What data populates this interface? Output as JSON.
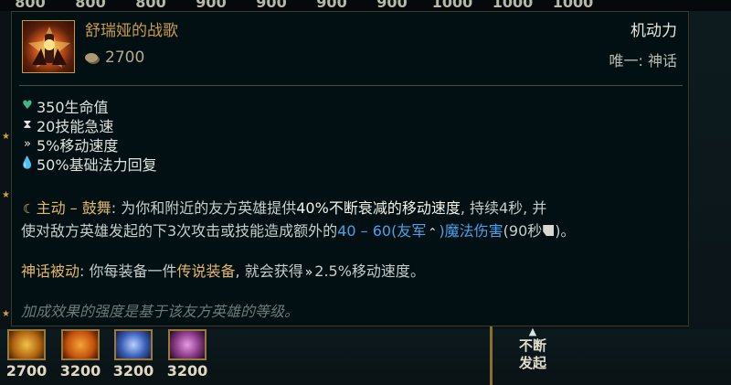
{
  "background": {
    "top_prices": [
      "800",
      "800",
      "800",
      "900",
      "900",
      "900",
      "900",
      "1000",
      "1000",
      "1000"
    ],
    "shop_items": [
      {
        "price": "2700",
        "color": "#d08a1c"
      },
      {
        "price": "3200",
        "color": "#d36a10"
      },
      {
        "price": "3200",
        "color": "#3a5fb8"
      },
      {
        "price": "3200",
        "color": "#8a3a88"
      }
    ],
    "side_item": {
      "line1": "不断",
      "line2": "发起"
    }
  },
  "tooltip": {
    "item_name": "舒瑞娅的战歌",
    "cost": "2700",
    "category": "机动力",
    "unique": "唯一: 神话",
    "stats": [
      {
        "icon": "heart-icon",
        "text": "350生命值"
      },
      {
        "icon": "hourglass-icon",
        "text": "20技能急速"
      },
      {
        "icon": "movement-speed-icon",
        "text": "5%移动速度"
      },
      {
        "icon": "mana-regen-icon",
        "text": "50%基础法力回复"
      }
    ],
    "active": {
      "label": "主动 – 鼓舞",
      "colon": ":",
      "t1": "为你和附近的友方英雄提供",
      "t2": "40%不断衰减的移动速度",
      "t3": ", 持续4秒, 并",
      "t4": "使对敌方英雄发起的下3次攻击或技能造成额外的",
      "t5": "40 – 60(友军",
      "t6": ")魔法伤害",
      "t7": "(90秒",
      "t8": ")。"
    },
    "mythic": {
      "label": "神话被动",
      "t1": ": 你每装备一件",
      "t2": "传说装备",
      "t3": ", 就会获得",
      "t4": "2.5%移动速度",
      "t5": "。"
    },
    "footnote": "加成效果的强度是基于该友方英雄的等级。"
  }
}
